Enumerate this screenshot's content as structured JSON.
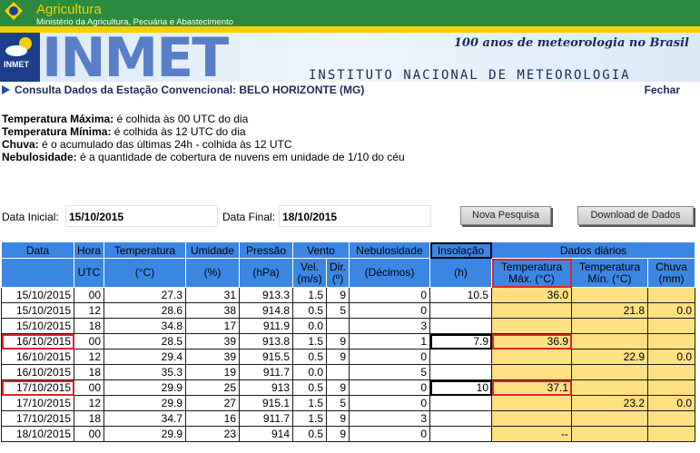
{
  "gov": {
    "title": "Agricultura",
    "subtitle": "Ministério da Agricultura, Pecuária e Abastecimento"
  },
  "banner": {
    "logo_text": "INMET",
    "big_text": "INMET",
    "slogan": "100 anos de meteorologia no Brasil",
    "instituto": "INSTITUTO NACIONAL DE METEOROLOGIA"
  },
  "station": {
    "label": "Consulta Dados da Estação Convencional: BELO HORIZONTE (MG)",
    "fechar": "Fechar"
  },
  "notes": [
    {
      "term": "Temperatura Máxima:",
      "text": " é colhida às 00 UTC do dia"
    },
    {
      "term": "Temperatura Mínima:",
      "text": " é colhida às 12 UTC do dia"
    },
    {
      "term": "Chuva:",
      "text": " é o acumulado das últimas 24h - colhida às 12 UTC"
    },
    {
      "term": "Nebulosidade:",
      "text": " é a quantidade de cobertura de nuvens em unidade de 1/10 do céu"
    }
  ],
  "dates": {
    "inicial_label": "Data Inicial:",
    "inicial_value": "15/10/2015",
    "final_label": "Data Final:",
    "final_value": "18/10/2015",
    "nova_pesquisa": "Nova Pesquisa",
    "download": "Download de Dados"
  },
  "table": {
    "head1": {
      "data": "Data",
      "hora": "Hora",
      "temperatura": "Temperatura",
      "umidade": "Umidade",
      "pressao": "Pressão",
      "vento": "Vento",
      "nebulosidade": "Nebulosidade",
      "insolacao": "Insolação",
      "dados_diarios": "Dados diários"
    },
    "head2": {
      "utc": "UTC",
      "temp_unit": "(°C)",
      "umid_unit": "(%)",
      "press_unit": "(hPa)",
      "vel": "Vel.",
      "vel_unit": "(m/s)",
      "dir": "Dir.",
      "dir_unit": "(º)",
      "neb_unit": "(Décimos)",
      "ins_unit": "(h)",
      "tmax": "Temperatura",
      "tmax_unit": "Máx. (°C)",
      "tmin": "Temperatura",
      "tmin_unit": "Mín. (°C)",
      "chuva": "Chuva",
      "chuva_unit": "(mm)"
    },
    "rows": [
      {
        "data": "15/10/2015",
        "hora": "00",
        "temp": "27.3",
        "umid": "31",
        "press": "913.3",
        "vel": "1.5",
        "dir": "9",
        "neb": "0",
        "ins": "10.5",
        "tmax": "36.0",
        "tmin": "",
        "chuva": ""
      },
      {
        "data": "15/10/2015",
        "hora": "12",
        "temp": "28.6",
        "umid": "38",
        "press": "914.8",
        "vel": "0.5",
        "dir": "5",
        "neb": "0",
        "ins": "",
        "tmax": "",
        "tmin": "21.8",
        "chuva": "0.0"
      },
      {
        "data": "15/10/2015",
        "hora": "18",
        "temp": "34.8",
        "umid": "17",
        "press": "911.9",
        "vel": "0.0",
        "dir": "",
        "neb": "3",
        "ins": "",
        "tmax": "",
        "tmin": "",
        "chuva": ""
      },
      {
        "data": "16/10/2015",
        "hora": "00",
        "temp": "28.5",
        "umid": "39",
        "press": "913.8",
        "vel": "1.5",
        "dir": "9",
        "neb": "1",
        "ins": "7.9",
        "tmax": "36.9",
        "tmin": "",
        "chuva": ""
      },
      {
        "data": "16/10/2015",
        "hora": "12",
        "temp": "29.4",
        "umid": "39",
        "press": "915.5",
        "vel": "0.5",
        "dir": "9",
        "neb": "0",
        "ins": "",
        "tmax": "",
        "tmin": "22.9",
        "chuva": "0.0"
      },
      {
        "data": "16/10/2015",
        "hora": "18",
        "temp": "35.3",
        "umid": "19",
        "press": "911.7",
        "vel": "0.0",
        "dir": "",
        "neb": "5",
        "ins": "",
        "tmax": "",
        "tmin": "",
        "chuva": ""
      },
      {
        "data": "17/10/2015",
        "hora": "00",
        "temp": "29.9",
        "umid": "25",
        "press": "913",
        "vel": "0.5",
        "dir": "9",
        "neb": "0",
        "ins": "10",
        "tmax": "37.1",
        "tmin": "",
        "chuva": ""
      },
      {
        "data": "17/10/2015",
        "hora": "12",
        "temp": "29.9",
        "umid": "27",
        "press": "915.1",
        "vel": "1.5",
        "dir": "5",
        "neb": "0",
        "ins": "",
        "tmax": "",
        "tmin": "23.2",
        "chuva": "0.0"
      },
      {
        "data": "17/10/2015",
        "hora": "18",
        "temp": "34.7",
        "umid": "16",
        "press": "911.7",
        "vel": "1.5",
        "dir": "9",
        "neb": "3",
        "ins": "",
        "tmax": "",
        "tmin": "",
        "chuva": ""
      },
      {
        "data": "18/10/2015",
        "hora": "00",
        "temp": "29.9",
        "umid": "23",
        "press": "914",
        "vel": "0.5",
        "dir": "9",
        "neb": "0",
        "ins": "",
        "tmax": "--",
        "tmin": "",
        "chuva": ""
      }
    ]
  },
  "colors": {
    "header_blue": "#3b86e3",
    "daily_yellow": "#ffe082",
    "highlight_red": "#d9262b",
    "gov_green": "#2b8a3e",
    "gov_yellow": "#f5d000"
  }
}
